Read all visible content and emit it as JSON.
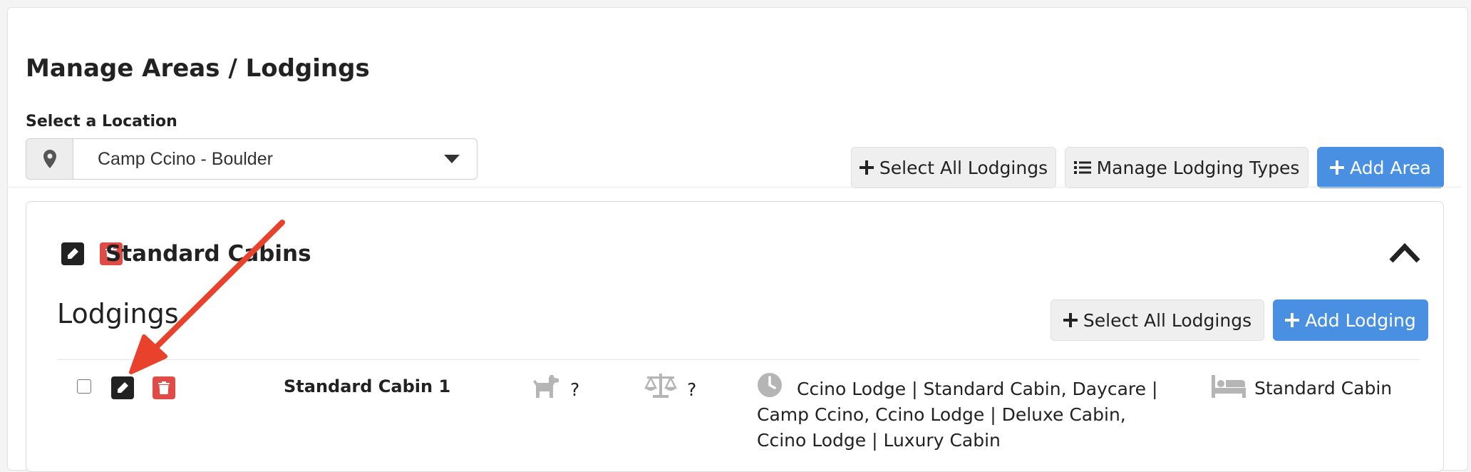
{
  "page": {
    "title": "Manage Areas / Lodgings",
    "location_label": "Select a Location",
    "location_value": "Camp Ccino - Boulder"
  },
  "toolbar": {
    "select_all_lodgings": "Select All Lodgings",
    "manage_lodging_types": "Manage Lodging Types",
    "add_area": "Add Area"
  },
  "area": {
    "name": "Standard Cabins",
    "lodgings_heading": "Lodgings",
    "select_all_lodgings": "Select All Lodgings",
    "add_lodging": "Add Lodging",
    "lodgings": [
      {
        "name": "Standard Cabin 1",
        "pets": "?",
        "policy": "?",
        "availability": "Ccino Lodge | Standard Cabin, Daycare | Camp Ccino, Ccino Lodge | Deluxe Cabin, Ccino Lodge | Luxury Cabin",
        "type": "Standard Cabin"
      }
    ]
  },
  "colors": {
    "primary": "#4a90e2",
    "danger": "#e04b47",
    "dark": "#222222",
    "annotation_arrow": "#e8412c"
  },
  "icons": [
    "map-marker-icon",
    "caret-down-icon",
    "plus-icon",
    "list-icon",
    "edit-icon",
    "trash-icon",
    "chevron-up-icon",
    "dog-icon",
    "scale-icon",
    "clock-icon",
    "bed-icon",
    "annotation-arrow"
  ]
}
